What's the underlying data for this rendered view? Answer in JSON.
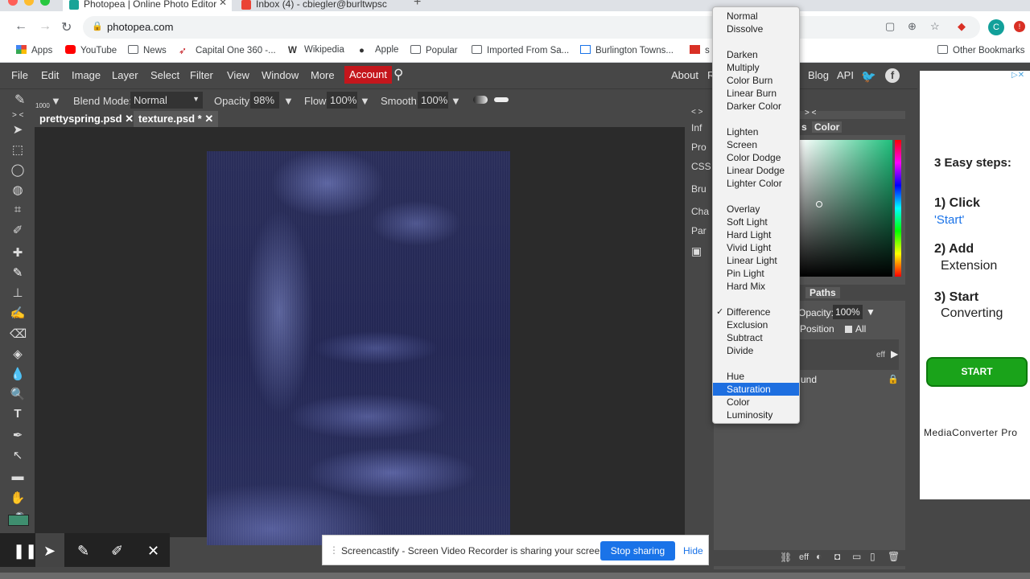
{
  "browser": {
    "tabs": [
      {
        "title": "Photopea | Online Photo Editor",
        "active": true
      },
      {
        "title": "Inbox (4) - cbiegler@burltwpsc",
        "active": false
      }
    ],
    "new_tab": "+",
    "url": "photopea.com",
    "profile_initial": "C",
    "bookmarks": [
      {
        "label": "Apps",
        "icon": "apps-grid-icon"
      },
      {
        "label": "YouTube",
        "icon": "youtube-icon"
      },
      {
        "label": "News",
        "icon": "folder-icon"
      },
      {
        "label": "Capital One 360 -...",
        "icon": "capital-one-icon"
      },
      {
        "label": "Wikipedia",
        "icon": "wikipedia-icon"
      },
      {
        "label": "Apple",
        "icon": "apple-icon"
      },
      {
        "label": "Popular",
        "icon": "folder-icon"
      },
      {
        "label": "Imported From Sa...",
        "icon": "folder-icon"
      },
      {
        "label": "Burlington Towns...",
        "icon": "site-icon"
      },
      {
        "label": "s",
        "icon": "site-icon"
      }
    ],
    "other_bookmarks": "Other Bookmarks"
  },
  "menubar": {
    "items": [
      "File",
      "Edit",
      "Image",
      "Layer",
      "Select",
      "Filter",
      "View",
      "Window",
      "More"
    ],
    "account": "Account",
    "right_items": [
      "About",
      "R",
      "Blog",
      "API"
    ]
  },
  "options": {
    "brush_size": "1000",
    "blend_label": "Blend Mode:",
    "blend_value": "Normal",
    "opacity_label": "Opacity:",
    "opacity_value": "98%",
    "flow_label": "Flow:",
    "flow_value": "100%",
    "smooth_label": "Smooth:",
    "smooth_value": "100%"
  },
  "doc_tabs": [
    {
      "name": "prettyspring.psd",
      "selected": false
    },
    {
      "name": "texture.psd *",
      "selected": true
    }
  ],
  "collapse_left": "> <",
  "mid_panel": {
    "collapse": "< >",
    "items": [
      "Inf",
      "Pro",
      "CSS",
      "Bru",
      "Cha",
      "Par"
    ]
  },
  "right_panel": {
    "collapse": "> <",
    "tabs_top": [
      "s",
      "Color"
    ],
    "tabs_mid": [
      "Paths"
    ],
    "opacity_label": "Opacity:",
    "opacity_value": "100%",
    "position_label": "Position",
    "all_label": "All",
    "layer_name": "und",
    "eff_label": "eff",
    "footer_eff": "eff"
  },
  "blend_menu": {
    "groups": [
      [
        "Normal",
        "Dissolve"
      ],
      [
        "Darken",
        "Multiply",
        "Color Burn",
        "Linear Burn",
        "Darker Color"
      ],
      [
        "Lighten",
        "Screen",
        "Color Dodge",
        "Linear Dodge",
        "Lighter Color"
      ],
      [
        "Overlay",
        "Soft Light",
        "Hard Light",
        "Vivid Light",
        "Linear Light",
        "Pin Light",
        "Hard Mix"
      ],
      [
        "Difference",
        "Exclusion",
        "Subtract",
        "Divide"
      ],
      [
        "Hue",
        "Saturation",
        "Color",
        "Luminosity"
      ]
    ],
    "checked": "Difference",
    "highlighted": "Saturation"
  },
  "ad": {
    "title": "3 Easy steps:",
    "step1": "1) Click",
    "step1b": "'Start'",
    "step2": "2) Add",
    "step2b": "Extension",
    "step3": "3) Start",
    "step3b": "Converting",
    "button": "START",
    "footer": "MediaConverter Pro"
  },
  "screencastify": {
    "message": "Screencastify - Screen Video Recorder is sharing your screen.",
    "stop": "Stop sharing",
    "hide": "Hide"
  },
  "colors": {
    "accent_account": "#c4161c",
    "menu_highlight": "#1e6fe0",
    "stop_button": "#1a73e8",
    "ad_button": "#1aa31a",
    "image_tint": "#2a2e5a"
  }
}
